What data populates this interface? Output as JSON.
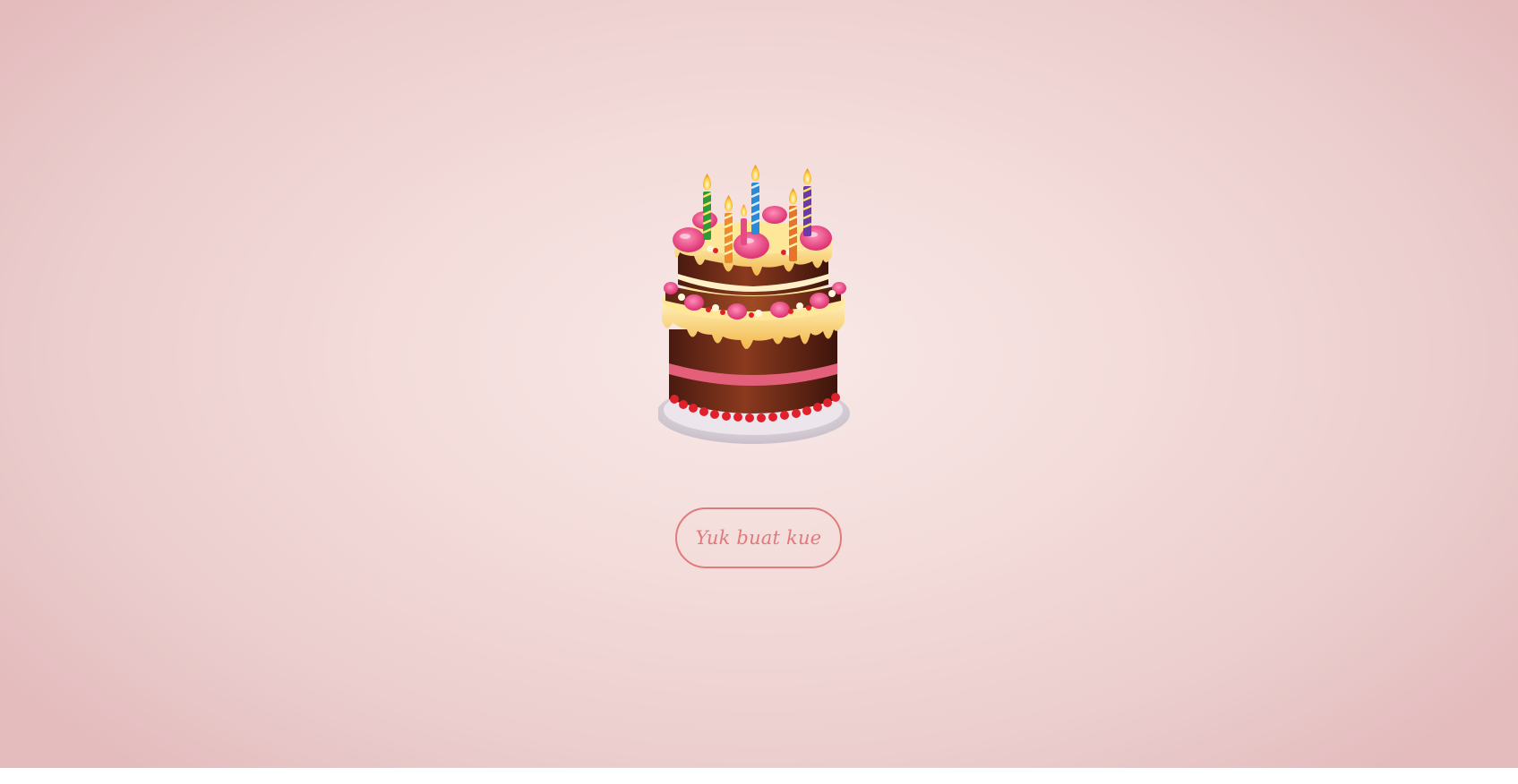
{
  "page": {
    "background_center": "#f8e9e7",
    "background_edge": "#e4bcbe"
  },
  "cake": {
    "icon": "birthday-cake-icon",
    "candle_count": 6
  },
  "action_button": {
    "label": "Yuk buat kue",
    "color": "#e07a7c"
  }
}
